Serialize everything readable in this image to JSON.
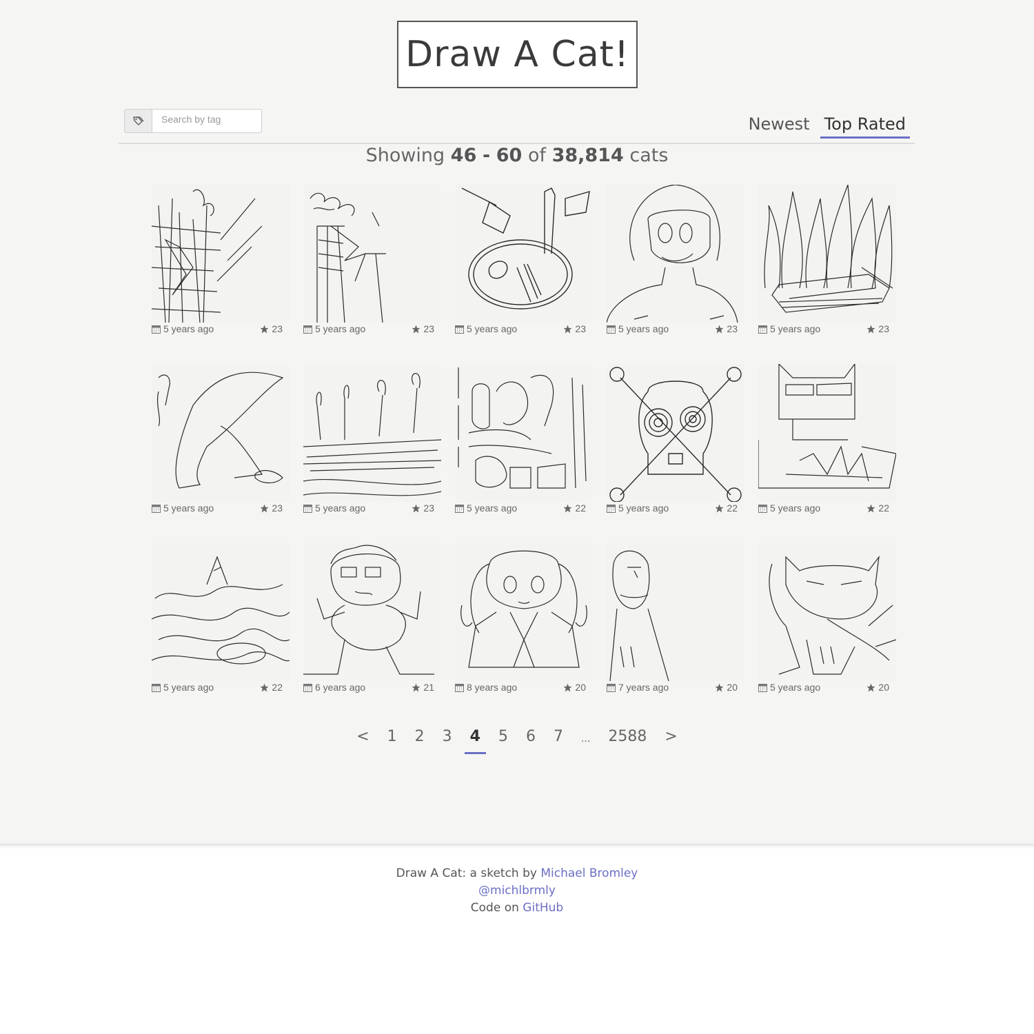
{
  "header": {
    "logo": "Draw A Cat!"
  },
  "toolbar": {
    "tag_icon": "tag-icon",
    "search_placeholder": "Search by tag",
    "sort_tabs": [
      {
        "label": "Newest",
        "active": false
      },
      {
        "label": "Top Rated",
        "active": true
      }
    ]
  },
  "showing": {
    "prefix": "Showing",
    "from": "46",
    "dash": "-",
    "to": "60",
    "of": "of",
    "total": "38,814",
    "suffix": "cats"
  },
  "cats": [
    {
      "subject": "sketch",
      "date": "5 years ago",
      "rating": "23"
    },
    {
      "subject": "sketch",
      "date": "5 years ago",
      "rating": "23"
    },
    {
      "subject": "sketch",
      "date": "5 years ago",
      "rating": "23"
    },
    {
      "subject": "sketch",
      "date": "5 years ago",
      "rating": "23"
    },
    {
      "subject": "sketch",
      "date": "5 years ago",
      "rating": "23"
    },
    {
      "subject": "sketch",
      "date": "5 years ago",
      "rating": "23"
    },
    {
      "subject": "sketch",
      "date": "5 years ago",
      "rating": "23"
    },
    {
      "subject": "sketch",
      "date": "5 years ago",
      "rating": "22"
    },
    {
      "subject": "sketch",
      "date": "5 years ago",
      "rating": "22"
    },
    {
      "subject": "sketch",
      "date": "5 years ago",
      "rating": "22"
    },
    {
      "subject": "sketch",
      "date": "5 years ago",
      "rating": "22"
    },
    {
      "subject": "sketch",
      "date": "6 years ago",
      "rating": "21"
    },
    {
      "subject": "sketch",
      "date": "8 years ago",
      "rating": "20"
    },
    {
      "subject": "sketch",
      "date": "7 years ago",
      "rating": "20"
    },
    {
      "subject": "sketch",
      "date": "5 years ago",
      "rating": "20"
    }
  ],
  "pagination": {
    "prev": "<",
    "pages": [
      "1",
      "2",
      "3",
      "4",
      "5",
      "6",
      "7",
      "...",
      "2588"
    ],
    "current": "4",
    "next": ">"
  },
  "footer": {
    "line1_text": "Draw A Cat: a sketch by",
    "author_link": "Michael Bromley",
    "twitter_link": "@michlbrmly",
    "line3_text": "Code on",
    "github_link": "GitHub"
  }
}
